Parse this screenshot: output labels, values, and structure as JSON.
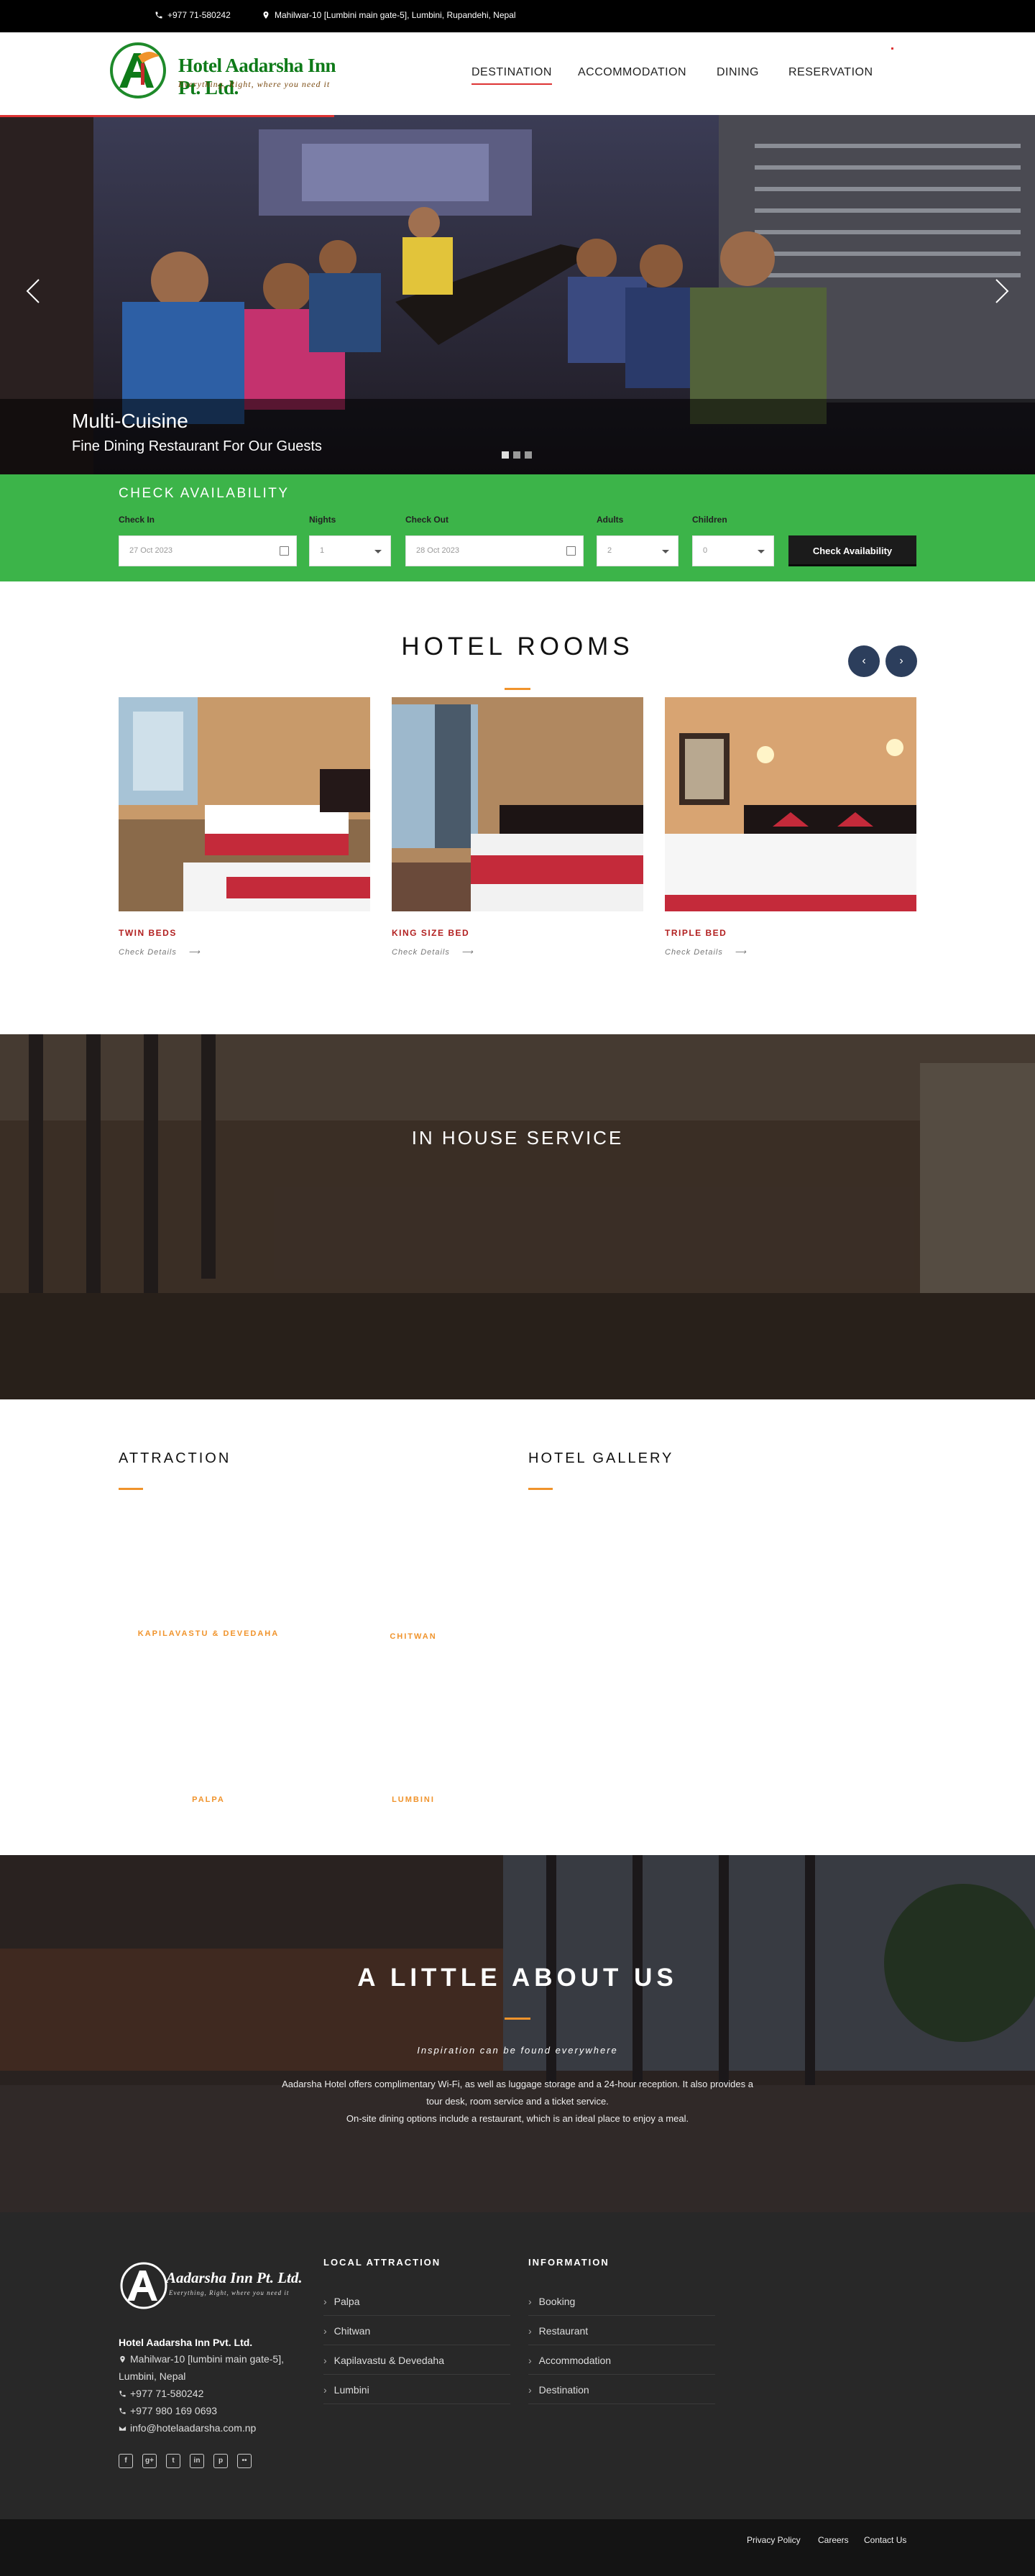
{
  "topbar": {
    "phone": "+977 71-580242",
    "address": "Mahilwar-10 [Lumbini main gate-5], Lumbini, Rupandehi, Nepal"
  },
  "brand": {
    "name": "Hotel Aadarsha Inn Pt. Ltd.",
    "tagline": "Everything, Right, where you need it"
  },
  "nav": [
    {
      "label": "DESTINATION",
      "active": true
    },
    {
      "label": "ACCOMMODATION",
      "active": false
    },
    {
      "label": "DINING",
      "active": false
    },
    {
      "label": "RESERVATION",
      "active": false
    }
  ],
  "hero": {
    "title": "Multi-Cuisine",
    "subtitle": "Fine Dining Restaurant For Our Guests",
    "slides": 3,
    "active_slide": 1
  },
  "availability": {
    "title": "CHECK AVAILABILITY",
    "check_in_label": "Check In",
    "check_in_value": "27 Oct 2023",
    "nights_label": "Nights",
    "nights_value": "1",
    "check_out_label": "Check Out",
    "check_out_value": "28 Oct 2023",
    "adults_label": "Adults",
    "adults_value": "2",
    "children_label": "Children",
    "children_value": "0",
    "button": "Check Availability"
  },
  "rooms": {
    "title": "HOTEL ROOMS",
    "prev_icon": "‹",
    "next_icon": "›",
    "items": [
      {
        "name": "TWIN BEDS",
        "link": "Check Details"
      },
      {
        "name": "KING SIZE BED",
        "link": "Check Details"
      },
      {
        "name": "TRIPLE BED",
        "link": "Check Details"
      }
    ]
  },
  "inhouse": {
    "title": "IN HOUSE SERVICE"
  },
  "attraction": {
    "title": "ATTRACTION",
    "items": [
      "KAPILAVASTU & DEVEDAHA",
      "CHITWAN",
      "PALPA",
      "LUMBINI"
    ]
  },
  "gallery": {
    "title": "HOTEL GALLERY"
  },
  "about": {
    "title": "A LITTLE ABOUT US",
    "subtitle": "Inspiration can be found everywhere",
    "body_1": "Aadarsha Hotel offers complimentary Wi-Fi, as well as luggage storage and a 24-hour reception. It also provides a tour desk, room service and a ticket service.",
    "body_2": "On-site dining options include a restaurant, which is an ideal place to enjoy a meal."
  },
  "footer": {
    "logo_text": "Aadarsha Inn Pt. Ltd.",
    "logo_tag": "Everything, Right, where you need it",
    "company": "Hotel Aadarsha Inn Pvt. Ltd.",
    "address_1": "Mahilwar-10 [lumbini main gate-5],",
    "address_2": "Lumbini, Nepal",
    "phone_1": "+977 71-580242",
    "phone_2": "+977 980 169 0693",
    "email": "info@hotelaadarsha.com.np",
    "local_title": "LOCAL ATTRACTION",
    "local": [
      "Palpa",
      "Chitwan",
      "Kapilavastu & Devedaha",
      "Lumbini"
    ],
    "info_title": "INFORMATION",
    "info": [
      "Booking",
      "Restaurant",
      "Accommodation",
      "Destination"
    ],
    "social_icons": [
      "facebook-icon",
      "google-plus-icon",
      "twitter-icon",
      "linkedin-icon",
      "pinterest-icon",
      "flickr-icon"
    ]
  },
  "bottom": {
    "links": [
      "Privacy Policy",
      "Careers",
      "Contact Us"
    ]
  },
  "colors": {
    "accent_red": "#d33333",
    "green": "#3cb449",
    "orange": "#f0932b",
    "navy": "#2c3e5c"
  }
}
